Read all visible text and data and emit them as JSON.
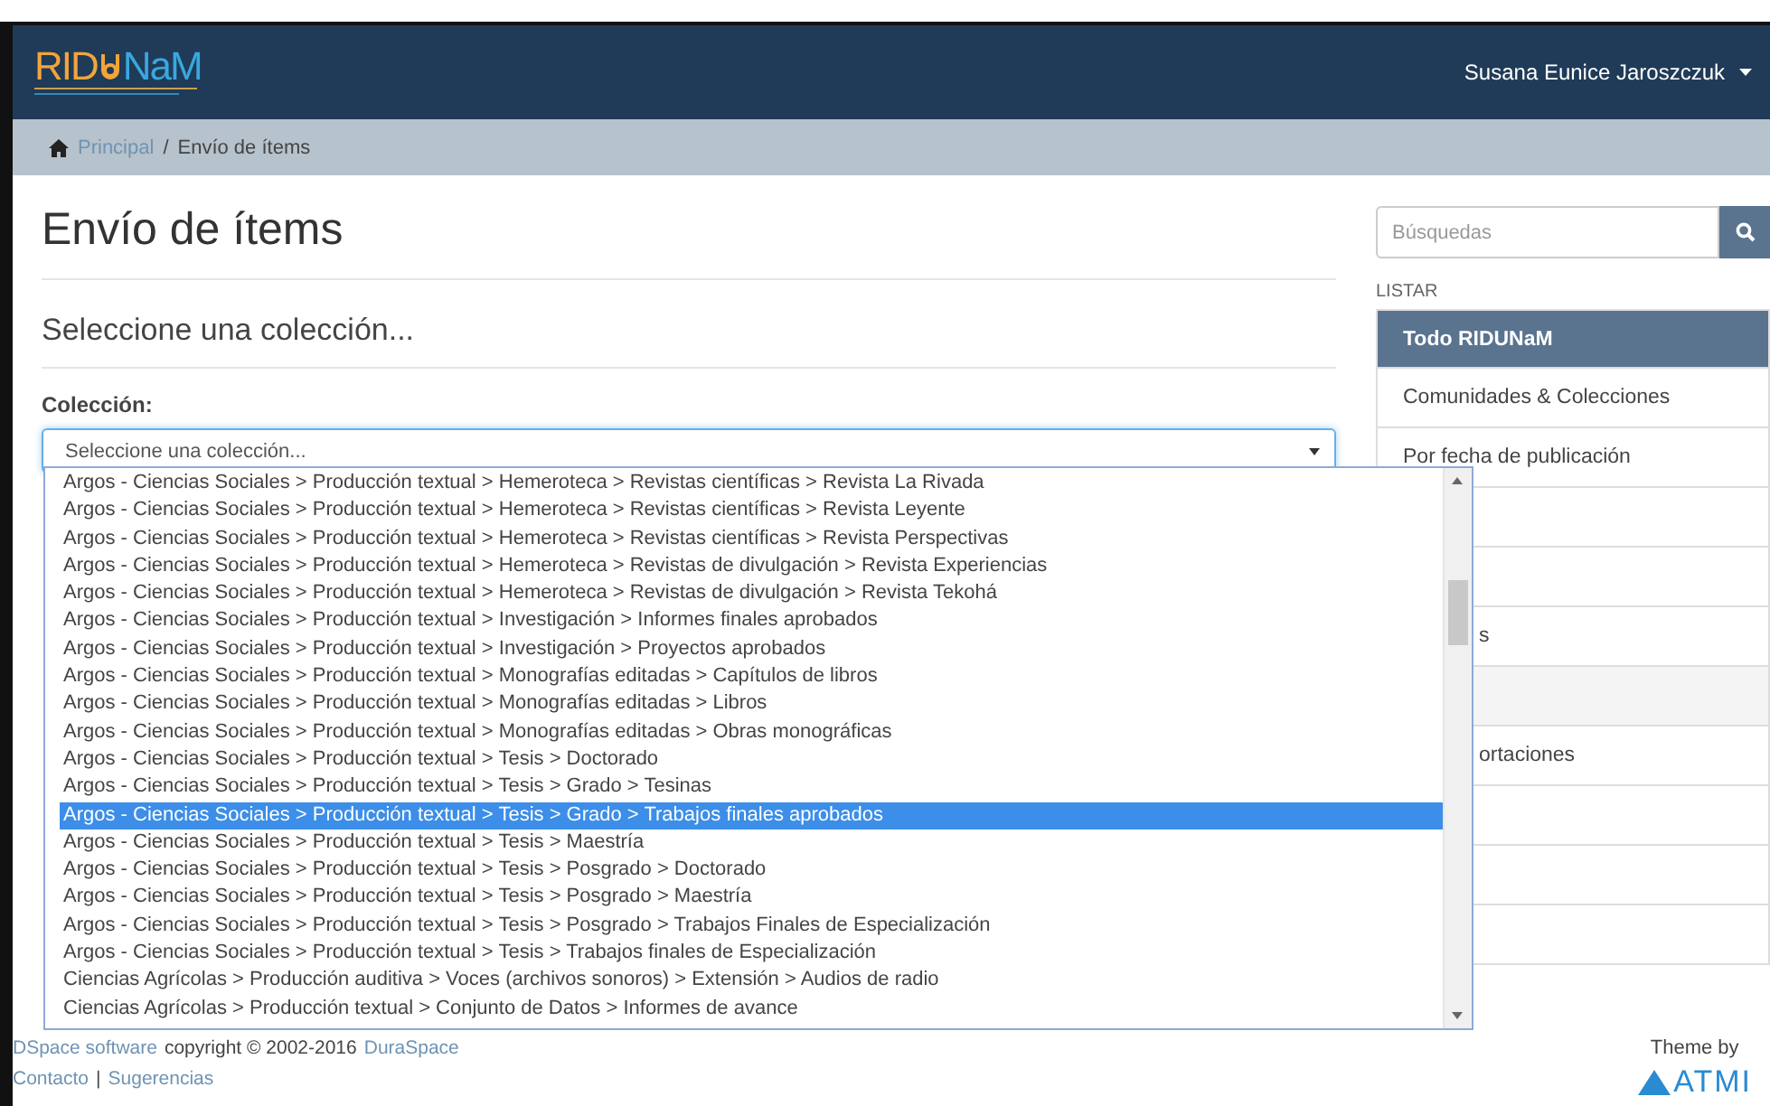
{
  "navbar": {
    "logo": {
      "left": "RID",
      "right": "NaM"
    },
    "user": "Susana Eunice Jaroszczuk"
  },
  "breadcrumb": {
    "separator": "/",
    "items": [
      {
        "label": "Principal",
        "link": true
      },
      {
        "label": "Envío de ítems",
        "link": false
      }
    ]
  },
  "page_title": "Envío de ítems",
  "section_title": "Seleccione una colección...",
  "collection_field": {
    "label": "Colección:",
    "value": "Seleccione una colección...",
    "expanded": true
  },
  "dropdown_options": [
    {
      "label": "Argos - Ciencias Sociales > Producción textual > Hemeroteca > Revistas científicas > Revista La Rivada",
      "selected": false
    },
    {
      "label": "Argos - Ciencias Sociales > Producción textual > Hemeroteca > Revistas científicas > Revista Leyente",
      "selected": false
    },
    {
      "label": "Argos - Ciencias Sociales > Producción textual > Hemeroteca > Revistas científicas > Revista Perspectivas",
      "selected": false
    },
    {
      "label": "Argos - Ciencias Sociales > Producción textual > Hemeroteca > Revistas de divulgación > Revista Experiencias",
      "selected": false
    },
    {
      "label": "Argos - Ciencias Sociales > Producción textual > Hemeroteca > Revistas de divulgación > Revista Tekohá",
      "selected": false
    },
    {
      "label": "Argos - Ciencias Sociales > Producción textual > Investigación > Informes finales aprobados",
      "selected": false
    },
    {
      "label": "Argos - Ciencias Sociales > Producción textual > Investigación > Proyectos aprobados",
      "selected": false
    },
    {
      "label": "Argos - Ciencias Sociales > Producción textual > Monografías editadas > Capítulos de libros",
      "selected": false
    },
    {
      "label": "Argos - Ciencias Sociales > Producción textual > Monografías editadas > Libros",
      "selected": false
    },
    {
      "label": "Argos - Ciencias Sociales > Producción textual > Monografías editadas > Obras monográficas",
      "selected": false
    },
    {
      "label": "Argos - Ciencias Sociales > Producción textual > Tesis > Doctorado",
      "selected": false
    },
    {
      "label": "Argos - Ciencias Sociales > Producción textual > Tesis > Grado > Tesinas",
      "selected": false
    },
    {
      "label": "Argos - Ciencias Sociales > Producción textual > Tesis > Grado > Trabajos finales aprobados",
      "selected": true
    },
    {
      "label": "Argos - Ciencias Sociales > Producción textual > Tesis > Maestría",
      "selected": false
    },
    {
      "label": "Argos - Ciencias Sociales > Producción textual > Tesis > Posgrado > Doctorado",
      "selected": false
    },
    {
      "label": "Argos - Ciencias Sociales > Producción textual > Tesis > Posgrado > Maestría",
      "selected": false
    },
    {
      "label": "Argos - Ciencias Sociales > Producción textual > Tesis > Posgrado > Trabajos Finales de Especialización",
      "selected": false
    },
    {
      "label": "Argos - Ciencias Sociales > Producción textual > Tesis > Trabajos finales de Especialización",
      "selected": false
    },
    {
      "label": "Ciencias Agrícolas > Producción auditiva > Voces (archivos sonoros) > Extensión > Audios de radio",
      "selected": false
    },
    {
      "label": "Ciencias Agrícolas > Producción textual > Conjunto de Datos > Informes de avance",
      "selected": false
    }
  ],
  "sidebar": {
    "search_placeholder": "Búsquedas",
    "heading": "LISTAR",
    "items": [
      {
        "kind": "item",
        "label": "Todo RIDUNaM",
        "selected": true
      },
      {
        "kind": "item",
        "label": "Comunidades & Colecciones",
        "selected": false
      },
      {
        "kind": "item",
        "label": "Por fecha de publicación",
        "selected": false
      },
      {
        "kind": "item",
        "selected": false
      },
      {
        "kind": "item",
        "selected": false
      },
      {
        "kind": "fragment",
        "label": "s",
        "selected": false
      },
      {
        "kind": "header",
        "selected": false
      },
      {
        "kind": "fragment",
        "label": "ortaciones",
        "selected": false
      },
      {
        "kind": "item",
        "selected": false
      },
      {
        "kind": "item",
        "selected": false
      },
      {
        "kind": "item",
        "selected": false
      }
    ]
  },
  "footer": {
    "software": "DSpace software",
    "copyright": "copyright © 2002-2016",
    "company": "DuraSpace",
    "links": [
      "Contacto",
      "Sugerencias"
    ],
    "separator": "|",
    "theme_by": "Theme by",
    "theme_logo": "ATMI"
  }
}
